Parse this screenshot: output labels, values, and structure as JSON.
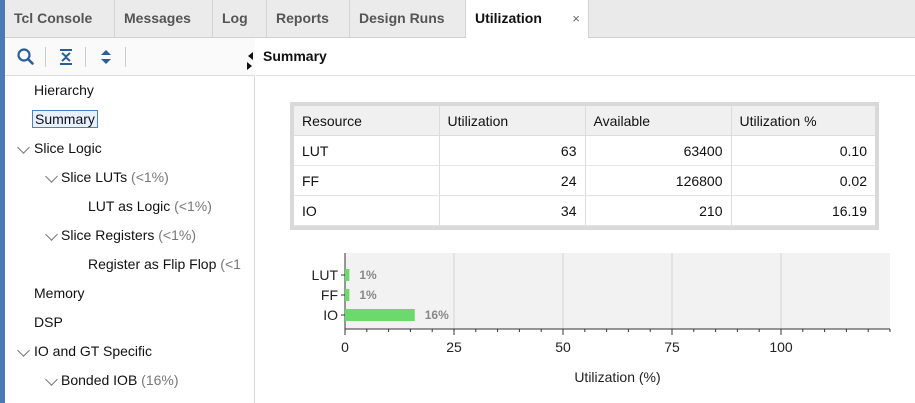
{
  "tabs": [
    {
      "label": "Tcl Console"
    },
    {
      "label": "Messages"
    },
    {
      "label": "Log"
    },
    {
      "label": "Reports"
    },
    {
      "label": "Design Runs"
    },
    {
      "label": "Utilization"
    }
  ],
  "active_tab_close": "×",
  "toolbar": {
    "icons": [
      "search-icon",
      "collapse-all-icon",
      "expand-all-icon"
    ]
  },
  "summary_title": "Summary",
  "tree": {
    "hierarchy": "Hierarchy",
    "summary": "Summary",
    "slice_logic": "Slice Logic",
    "slice_luts": "Slice LUTs",
    "slice_luts_pct": "(<1%)",
    "lut_as_logic": "LUT as Logic",
    "lut_as_logic_pct": "(<1%)",
    "slice_registers": "Slice Registers",
    "slice_registers_pct": "(<1%)",
    "register_as_ff": "Register as Flip Flop",
    "register_as_ff_pct": "(<1",
    "memory": "Memory",
    "dsp": "DSP",
    "io_gt": "IO and GT Specific",
    "bonded_iob": "Bonded IOB",
    "bonded_iob_pct": "(16%)"
  },
  "table": {
    "headers": [
      "Resource",
      "Utilization",
      "Available",
      "Utilization %"
    ],
    "rows": [
      [
        "LUT",
        "63",
        "63400",
        "0.10"
      ],
      [
        "FF",
        "24",
        "126800",
        "0.02"
      ],
      [
        "IO",
        "34",
        "210",
        "16.19"
      ]
    ]
  },
  "chart_data": {
    "type": "bar",
    "orientation": "horizontal",
    "categories": [
      "LUT",
      "FF",
      "IO"
    ],
    "values": [
      1,
      1,
      16
    ],
    "value_labels": [
      "1%",
      "1%",
      "16%"
    ],
    "xlabel": "Utilization (%)",
    "ylabel": "",
    "xlim": [
      0,
      125
    ],
    "xticks": [
      0,
      25,
      50,
      75,
      100
    ],
    "grid": true,
    "bar_color": "#6bd96b"
  },
  "colors": {
    "accent": "#4a7ab8",
    "bar": "#6bd96b",
    "plot_bg": "#f2f2f2"
  }
}
